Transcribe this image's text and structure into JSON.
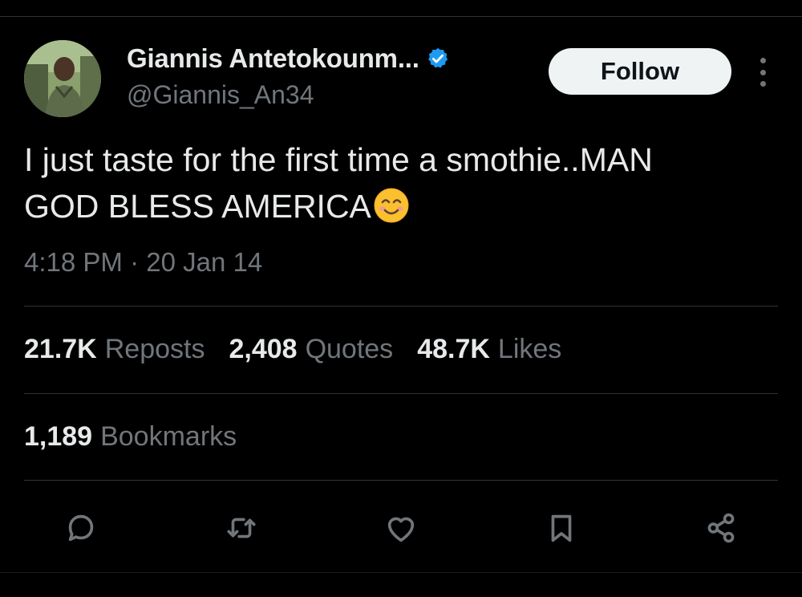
{
  "user": {
    "display_name": "Giannis Antetokounm...",
    "handle": "@Giannis_An34",
    "verified_color": "#1d9bf0"
  },
  "header": {
    "follow_label": "Follow",
    "more_icon": "more-vertical-icon"
  },
  "tweet": {
    "line1": "I just taste for the first time a smothie..MAN",
    "line2": "GOD BLESS AMERICA",
    "emoji": "smiling-face-emoji",
    "timestamp": "4:18 PM · 20 Jan 14"
  },
  "stats": {
    "reposts_count": "21.7K",
    "reposts_label": "Reposts",
    "quotes_count": "2,408",
    "quotes_label": "Quotes",
    "likes_count": "48.7K",
    "likes_label": "Likes",
    "bookmarks_count": "1,189",
    "bookmarks_label": "Bookmarks"
  },
  "actions": [
    "reply-icon",
    "repost-icon",
    "like-icon",
    "bookmark-icon",
    "share-icon"
  ],
  "colors": {
    "background": "#000000",
    "text_primary": "#e7e9ea",
    "text_secondary": "#71767b",
    "divider": "#2f3336",
    "follow_bg": "#eff3f4"
  }
}
